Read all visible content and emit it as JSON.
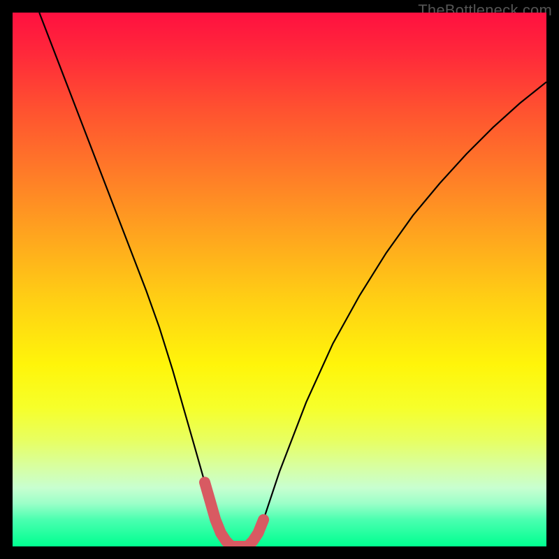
{
  "watermark": "TheBottleneck.com",
  "chart_data": {
    "type": "line",
    "title": "",
    "xlabel": "",
    "ylabel": "",
    "xlim": [
      0,
      100
    ],
    "ylim": [
      0,
      100
    ],
    "x": [
      5,
      10,
      15,
      20,
      25,
      27.5,
      30,
      32,
      34,
      36,
      37,
      38,
      39,
      40,
      41,
      42,
      43,
      44,
      45,
      46,
      47,
      48,
      50,
      55,
      60,
      65,
      70,
      75,
      80,
      85,
      90,
      95,
      100
    ],
    "values": [
      100,
      87,
      74,
      61,
      48,
      41,
      33,
      26,
      19,
      12,
      8.5,
      5,
      2.5,
      1,
      0,
      0,
      0,
      0,
      1,
      2.5,
      5,
      8,
      14,
      27,
      38,
      47,
      55,
      62,
      68,
      73.5,
      78.5,
      83,
      87
    ],
    "highlight_range_x": [
      36,
      47.5
    ],
    "gradient_stops": [
      {
        "pct": 0,
        "color": "#ff1040"
      },
      {
        "pct": 25,
        "color": "#ff7b28"
      },
      {
        "pct": 50,
        "color": "#ffd014"
      },
      {
        "pct": 75,
        "color": "#e8ff60"
      },
      {
        "pct": 100,
        "color": "#00ff90"
      }
    ]
  }
}
